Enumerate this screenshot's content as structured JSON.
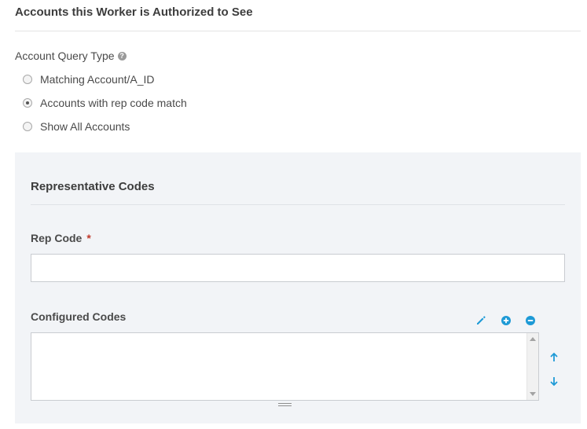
{
  "section": {
    "title": "Accounts this Worker is Authorized to See"
  },
  "query_type": {
    "label": "Account Query Type",
    "help_icon": "question-circle-icon",
    "options": [
      {
        "label": "Matching Account/A_ID",
        "checked": false
      },
      {
        "label": "Accounts with rep code match",
        "checked": true
      },
      {
        "label": "Show All Accounts",
        "checked": false
      }
    ]
  },
  "rep_codes": {
    "title": "Representative Codes",
    "rep_code_label": "Rep Code",
    "required_marker": "*",
    "rep_code_value": "",
    "configured_label": "Configured Codes",
    "configured_items": [],
    "tools": {
      "edit_icon": "pencil-icon",
      "add_icon": "plus-circle-icon",
      "remove_icon": "minus-circle-icon",
      "move_up_icon": "arrow-up-icon",
      "move_down_icon": "arrow-down-icon"
    },
    "accent_color": "#1e9ad6"
  }
}
